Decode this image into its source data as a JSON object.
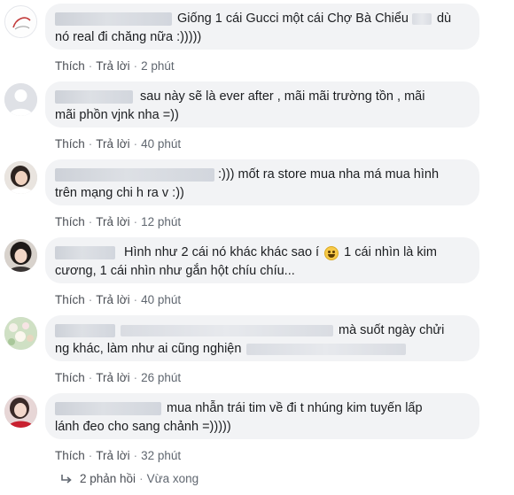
{
  "comments": [
    {
      "lines": [
        {
          "name_blur": true,
          "text": "Giống 1 cái Gucci một cái Chợ Bà Chiểu",
          "trail_blur": true,
          "trail_text": "dù"
        },
        {
          "text": "nó real đi chăng nữa :)))))"
        }
      ],
      "like": "Thích",
      "reply": "Trả lời",
      "time": "2 phút",
      "avatar_icon": "profile-avatar-sketch"
    },
    {
      "lines": [
        {
          "name_blur": true,
          "text": "sau này sẽ là ever after , mãi mãi trường tồn , mãi"
        },
        {
          "text": "mãi phồn vjnk nha =))"
        }
      ],
      "like": "Thích",
      "reply": "Trả lời",
      "time": "40 phút",
      "avatar_icon": "default-avatar"
    },
    {
      "lines": [
        {
          "name_blur": true,
          "text": ":))) mốt ra store mua nha má mua hình"
        },
        {
          "text": "trên mạng chi h ra v :))"
        }
      ],
      "like": "Thích",
      "reply": "Trả lời",
      "time": "12 phút",
      "avatar_icon": "profile-avatar-photo"
    },
    {
      "lines": [
        {
          "name_blur": true,
          "text": "Hình như 2 cái nó khác khác sao í",
          "emoji": true,
          "after_emoji": "1 cái nhìn là kim"
        },
        {
          "text": "cương, 1 cái nhìn như gắn hột chíu chíu..."
        }
      ],
      "like": "Thích",
      "reply": "Trả lời",
      "time": "40 phút",
      "avatar_icon": "profile-avatar-photo"
    },
    {
      "lines": [
        {
          "name_blur": true,
          "mid_blur": true,
          "text": "mà suốt ngày chửi"
        },
        {
          "text": "ng khác, làm như ai cũng nghiện",
          "trail_blur": true
        }
      ],
      "like": "Thích",
      "reply": "Trả lời",
      "time": "26 phút",
      "avatar_icon": "profile-avatar-flowers"
    },
    {
      "lines": [
        {
          "name_blur": true,
          "text": "mua nhẫn trái tim về đi t nhúng kim tuyến lấp"
        },
        {
          "text": "lánh đeo cho sang chảnh =)))))"
        }
      ],
      "like": "Thích",
      "reply": "Trả lời",
      "time": "32 phút",
      "avatar_icon": "profile-avatar-photo"
    }
  ],
  "replies_summary": {
    "count_label": "2 phản hồi",
    "status": "Vừa xong",
    "icon": "reply-arrow-icon"
  },
  "colors": {
    "bubble": "#f2f3f5",
    "text": "#1c1e21",
    "meta": "#606770"
  }
}
